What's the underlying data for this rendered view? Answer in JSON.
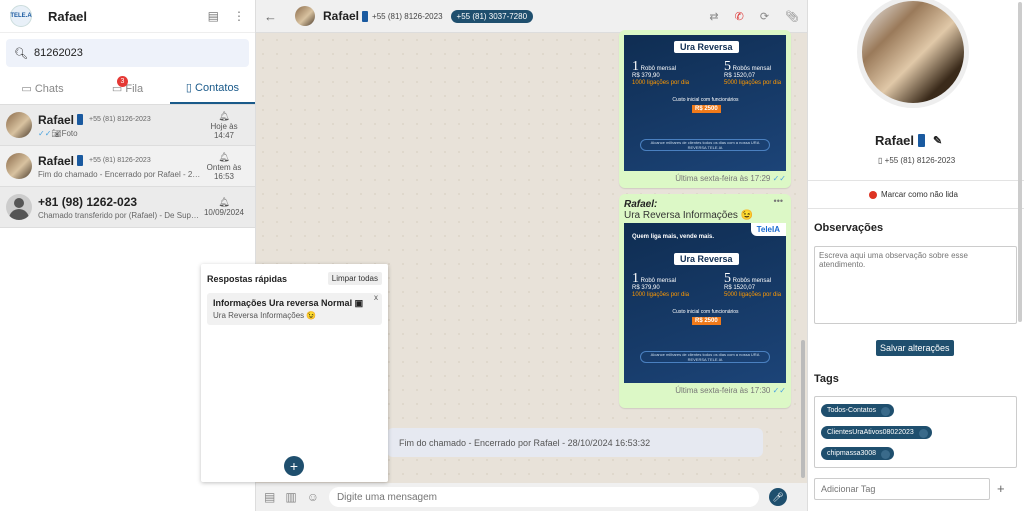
{
  "sidebar": {
    "user_name": "Rafael",
    "logo_text": "TELE.A",
    "search_value": "81262023",
    "tabs": [
      {
        "label": "Chats"
      },
      {
        "label": "Fila",
        "badge": "3"
      },
      {
        "label": "Contatos"
      }
    ],
    "contacts": [
      {
        "name": "Rafael",
        "phone": "+55 (81) 8126-2023",
        "message": "Foto",
        "time": "Hoje às 14:47"
      },
      {
        "name": "Rafael",
        "phone": "+55 (81) 8126-2023",
        "message": "Fim do chamado - Encerrado por Rafael - 28/1...",
        "time": "Ontem às 16:53"
      },
      {
        "name": "+81 (98) 1262-023",
        "phone": "",
        "message": "Chamado transferido por (Rafael) - De Suporte...",
        "time": "10/09/2024"
      }
    ]
  },
  "chat": {
    "name": "Rafael",
    "phone": "+55 (81) 8126-2023",
    "pill": "+55 (81) 3037-7280",
    "messages": [
      {
        "time": "Última sexta-feira às 17:29",
        "promo": {
          "title": "Ura Reversa",
          "left_big": "1",
          "left_label": "Robô mensal",
          "left_price": "R$ 379,90",
          "left_note": "1000 ligações por dia",
          "right_big": "5",
          "right_label": "Robôs mensal",
          "right_price": "R$ 1520,07",
          "right_note": "5000 ligações por dia",
          "setup_note": "Custo inicial com funcionários",
          "setup_price": "R$ 2500",
          "bottom": "Alcance milhares de clientes todos os dias com a nossa URA REVERSA TELE.IA"
        }
      },
      {
        "sender": "Rafael:",
        "caption": "Ura Reversa Informações 😉",
        "time": "Última sexta-feira às 17:30",
        "promo": {
          "logo": "TeleIA",
          "tagline": "Quem liga mais, vende mais.",
          "title": "Ura Reversa",
          "left_big": "1",
          "left_label": "Robô mensal",
          "left_price": "R$ 379,90",
          "left_note": "1000 ligações por dia",
          "right_big": "5",
          "right_label": "Robôs mensal",
          "right_price": "R$ 1520,07",
          "right_note": "5000 ligações por dia",
          "setup_note": "Custo inicial com funcionários",
          "setup_price": "R$ 2500",
          "bottom": "Alcance milhares de clientes todos os dias com a nossa URA REVERSA TELE.IA"
        }
      }
    ],
    "system_message": "Fim do chamado - Encerrado por Rafael - 28/10/2024 16:53:32",
    "composer_placeholder": "Digite uma mensagem"
  },
  "quick_replies": {
    "title": "Respostas rápidas",
    "clear_label": "Limpar todas",
    "items": [
      {
        "title": "Informações Ura reversa Normal",
        "subtitle": "Ura Reversa Informações 😉"
      }
    ],
    "add_label": "+"
  },
  "profile": {
    "name": "Rafael",
    "phone": "+55 (81) 8126-2023",
    "mark_unread_label": "Marcar como não lida",
    "obs_title": "Observações",
    "obs_placeholder": "Escreva aqui uma observação sobre esse atendimento.",
    "save_label": "Salvar alterações",
    "tags_title": "Tags",
    "tags": [
      "Todos-Contatos",
      "ClientesUraAtivos08022023",
      "chipmassa3008"
    ],
    "add_tag_placeholder": "Adicionar Tag"
  },
  "colors": {
    "accent": "#1f4f6e",
    "unread_dot": "#dd3322",
    "bubble": "#dcf8c6"
  }
}
